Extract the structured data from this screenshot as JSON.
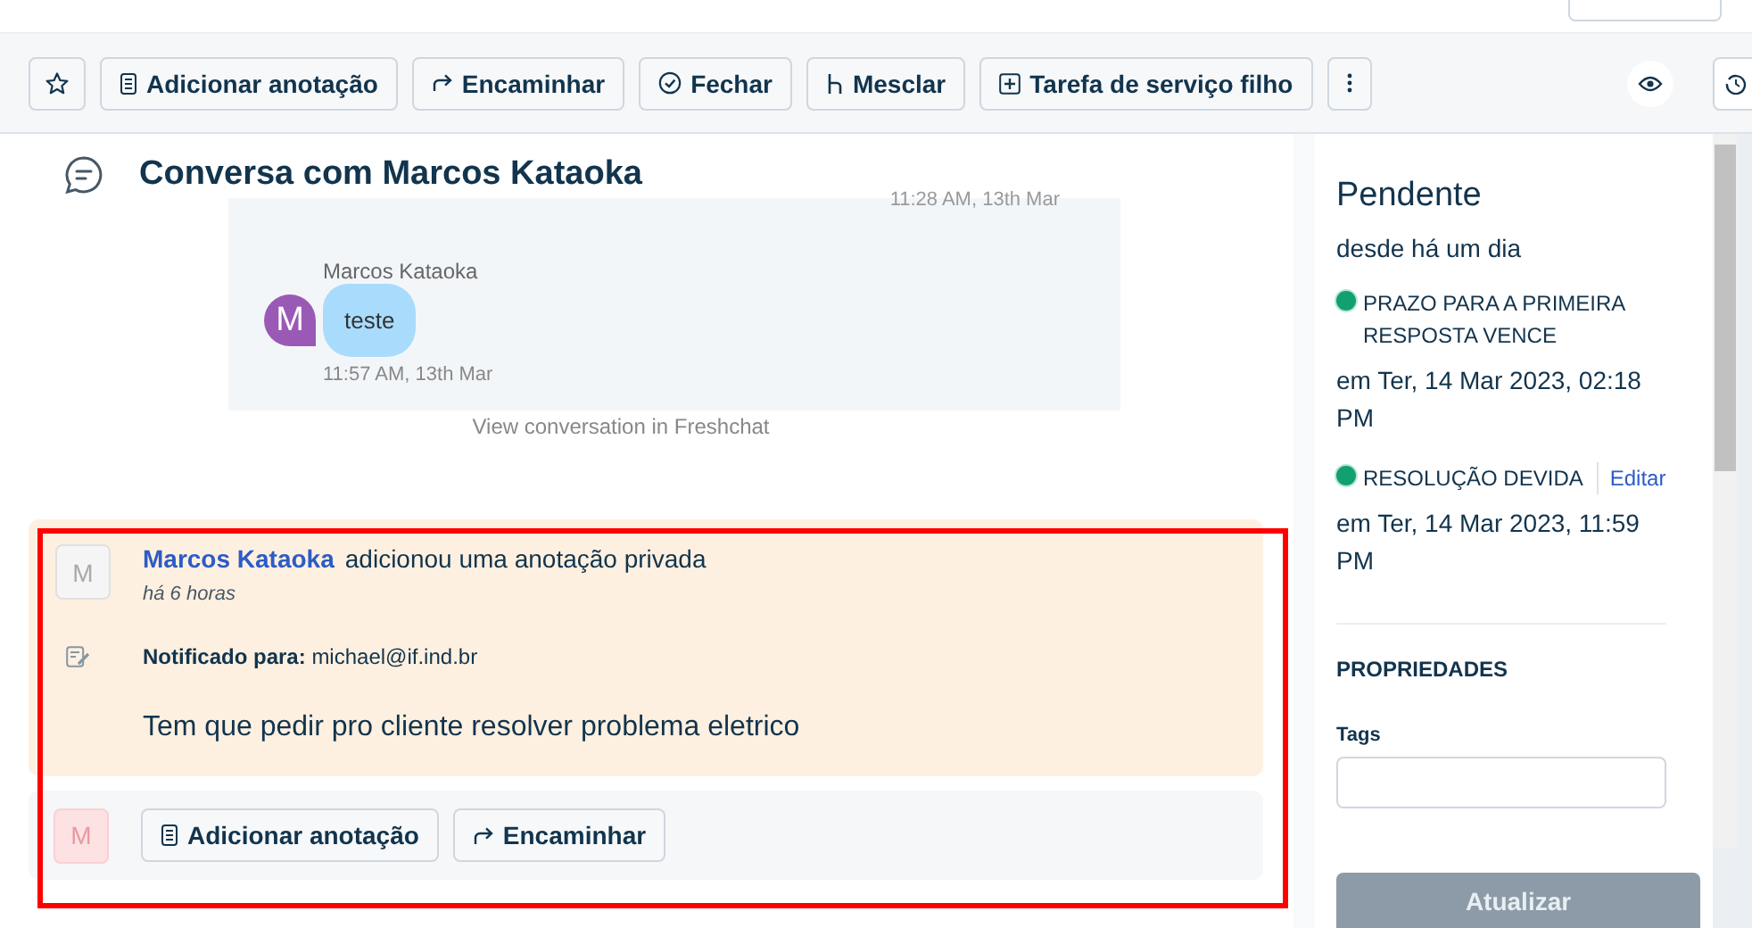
{
  "toolbar": {
    "buttons": [
      {
        "label": "Adicionar anotação"
      },
      {
        "label": "Encaminhar"
      },
      {
        "label": "Fechar"
      },
      {
        "label": "Mesclar"
      },
      {
        "label": "Tarefa de serviço filho"
      }
    ]
  },
  "conversation": {
    "title": "Conversa com Marcos Kataoka",
    "previous_time": "11:28 AM, 13th Mar",
    "sender": "Marcos Kataoka",
    "avatar": "M",
    "message": "teste",
    "time": "11:57 AM, 13th Mar",
    "link": "View conversation in Freshchat"
  },
  "note": {
    "avatar": "M",
    "author": "Marcos Kataoka",
    "action": "adicionou uma anotação privada",
    "age": "há 6 horas",
    "notified_label": "Notificado para:",
    "notified_to": "michael@if.ind.br",
    "body": "Tem que pedir pro cliente resolver problema eletrico"
  },
  "reply_bar": {
    "avatar": "M",
    "buttons": [
      {
        "label": "Adicionar anotação"
      },
      {
        "label": "Encaminhar"
      }
    ]
  },
  "sidebar": {
    "status": "Pendente",
    "since": "desde há um dia",
    "sla": [
      {
        "label": "PRAZO PARA A PRIMEIRA RESPOSTA VENCE",
        "due": "em Ter, 14 Mar 2023, 02:18 PM",
        "color": "#12a071"
      },
      {
        "label": "RESOLUÇÃO DEVIDA",
        "edit": "Editar",
        "due": "em Ter, 14 Mar 2023, 11:59 PM",
        "color": "#12a071"
      }
    ],
    "properties_title": "PROPRIEDADES",
    "tags_label": "Tags",
    "update_button": {
      "label": "Atualizar",
      "disabled": true
    }
  }
}
